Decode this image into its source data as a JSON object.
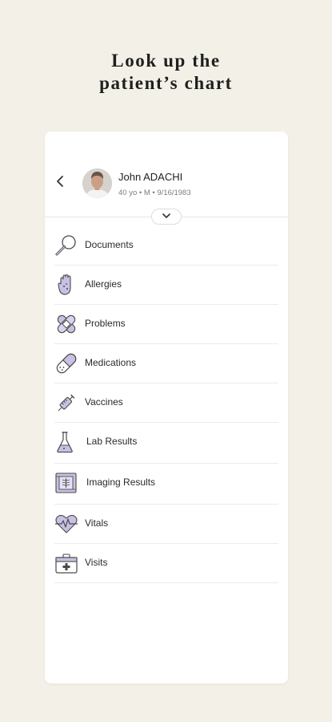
{
  "headline": {
    "line1": "Look up the",
    "line2": "patient’s chart"
  },
  "patient": {
    "name": "John ADACHI",
    "info": "40 yo • M • 9/16/1983"
  },
  "menu": [
    {
      "label": "Documents",
      "icon": "magnifier-icon"
    },
    {
      "label": "Allergies",
      "icon": "hand-icon"
    },
    {
      "label": "Problems",
      "icon": "bandages-icon"
    },
    {
      "label": "Medications",
      "icon": "pill-icon"
    },
    {
      "label": "Vaccines",
      "icon": "syringe-icon"
    },
    {
      "label": "Lab Results",
      "icon": "flask-icon"
    },
    {
      "label": "Imaging Results",
      "icon": "film-icon"
    },
    {
      "label": "Vitals",
      "icon": "heartbeat-icon"
    },
    {
      "label": "Visits",
      "icon": "medical-case-icon"
    }
  ],
  "colors": {
    "background": "#f3f1e7",
    "accent": "#c9c0e3",
    "ink": "#4a4a4a"
  }
}
